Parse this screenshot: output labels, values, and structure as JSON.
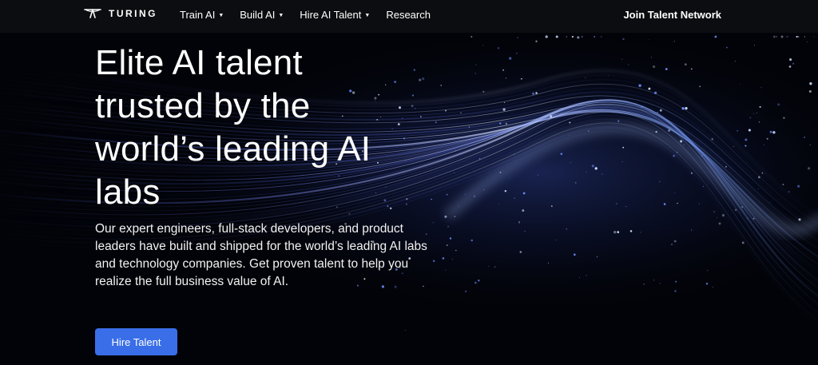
{
  "nav": {
    "logo_text": "TURING",
    "items": [
      {
        "label": "Train AI",
        "has_dropdown": true
      },
      {
        "label": "Build AI",
        "has_dropdown": true
      },
      {
        "label": "Hire AI Talent",
        "has_dropdown": true
      },
      {
        "label": "Research",
        "has_dropdown": false
      }
    ],
    "caret_glyph": "▼",
    "join_label": "Join Talent Network"
  },
  "hero": {
    "headline_lines": [
      "Elite AI talent",
      "trusted by the",
      "world’s leading AI",
      "labs"
    ],
    "subtext_lines": [
      "Our expert engineers, full-stack developers, and product",
      "leaders have built and shipped for the world’s leading AI labs",
      "and technology companies. Get proven talent to help you",
      "realize the full business value of AI."
    ],
    "cta_label": "Hire Talent"
  },
  "colors": {
    "nav_bg": "#0c0d10",
    "page_bg": "#020308",
    "cta_bg": "#3a6ee8",
    "accent_blue": "#4a7cff"
  }
}
